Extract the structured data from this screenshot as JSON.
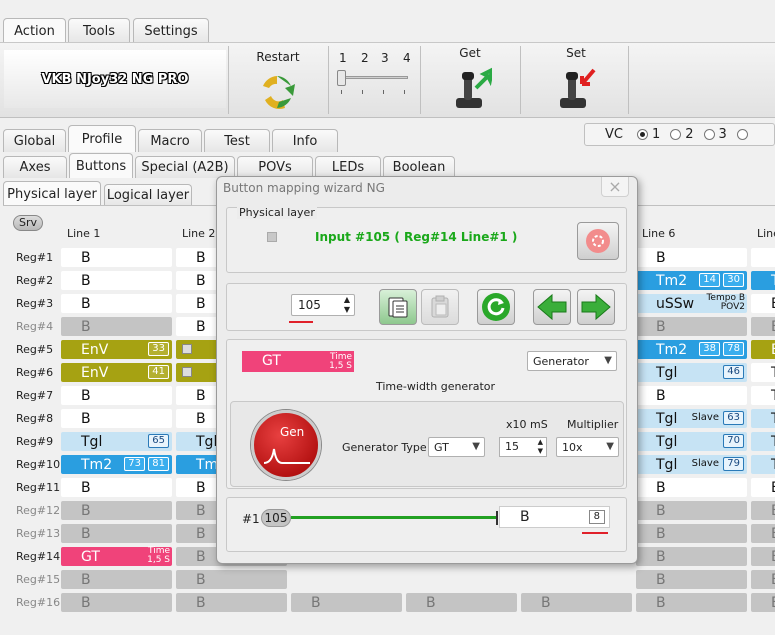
{
  "menu": {
    "tabs": [
      "Action",
      "Tools",
      "Settings"
    ]
  },
  "device": {
    "name": "VKB NJoy32 NG PRO"
  },
  "toolbar": {
    "restart_label": "Restart",
    "slider_ticks": [
      "1",
      "2",
      "3",
      "4"
    ],
    "get_label": "Get",
    "set_label": "Set"
  },
  "main_tabs": [
    "Global",
    "Profile",
    "Macro",
    "Test",
    "Info"
  ],
  "vc": {
    "label": "VC",
    "options": [
      "1",
      "2",
      "3",
      ""
    ],
    "selected": "1"
  },
  "sub_tabs": [
    "Axes",
    "Buttons",
    "Special (A2B)",
    "POVs",
    "LEDs",
    "Boolean"
  ],
  "layer_tabs": [
    "Physical layer",
    "Logical layer"
  ],
  "srv_label": "Srv",
  "line_headers": [
    "Line 1",
    "Line 2",
    "Line 6",
    "Line"
  ],
  "reg_labels": [
    "Reg#1",
    "Reg#2",
    "Reg#3",
    "Reg#4",
    "Reg#5",
    "Reg#6",
    "Reg#7",
    "Reg#8",
    "Reg#9",
    "Reg#10",
    "Reg#11",
    "Reg#12",
    "Reg#13",
    "Reg#14",
    "Reg#15",
    "Reg#16"
  ],
  "line1": [
    {
      "text": "B",
      "style": "white"
    },
    {
      "text": "B",
      "style": "white"
    },
    {
      "text": "B",
      "style": "white"
    },
    {
      "text": "B",
      "style": "gray"
    },
    {
      "text": "EnV",
      "style": "olive",
      "badges": [
        "33"
      ]
    },
    {
      "text": "EnV",
      "style": "olive",
      "badges": [
        "41"
      ]
    },
    {
      "text": "B",
      "style": "white"
    },
    {
      "text": "B",
      "style": "white"
    },
    {
      "text": "Tgl",
      "style": "lblue",
      "badges": [
        "65"
      ]
    },
    {
      "text": "Tm2",
      "style": "dblue",
      "badges": [
        "73",
        "81"
      ]
    },
    {
      "text": "B",
      "style": "white"
    },
    {
      "text": "B",
      "style": "gray"
    },
    {
      "text": "B",
      "style": "gray"
    },
    {
      "text": "GT",
      "style": "pink",
      "time": [
        "Time",
        "1,5 S"
      ]
    },
    {
      "text": "B",
      "style": "gray"
    },
    {
      "text": "B",
      "style": "gray"
    }
  ],
  "line2": [
    {
      "text": "B",
      "style": "white"
    },
    {
      "text": "B",
      "style": "white"
    },
    {
      "text": "B",
      "style": "white"
    },
    {
      "text": "B",
      "style": "white"
    },
    {
      "text": "",
      "style": "olive"
    },
    {
      "text": "",
      "style": "olive"
    },
    {
      "text": "B",
      "style": "white"
    },
    {
      "text": "B",
      "style": "white"
    },
    {
      "text": "Tgl",
      "style": "lblue"
    },
    {
      "text": "Tm",
      "style": "dblue"
    },
    {
      "text": "B",
      "style": "white"
    },
    {
      "text": "B",
      "style": "gray"
    },
    {
      "text": "B",
      "style": "gray"
    },
    {
      "text": "B",
      "style": "gray"
    },
    {
      "text": "B",
      "style": "gray"
    },
    {
      "text": "B",
      "style": "gray"
    }
  ],
  "line6": [
    {
      "text": "B",
      "style": "white"
    },
    {
      "text": "Tm2",
      "style": "dblue",
      "badges": [
        "14",
        "30"
      ]
    },
    {
      "text": "uSSw",
      "style": "lblue",
      "time": [
        "Tempo B",
        "POV2"
      ]
    },
    {
      "text": "B",
      "style": "gray"
    },
    {
      "text": "Tm2",
      "style": "dblue",
      "badges": [
        "38",
        "78"
      ]
    },
    {
      "text": "Tgl",
      "style": "lblue",
      "badges": [
        "46"
      ]
    },
    {
      "text": "B",
      "style": "white"
    },
    {
      "text": "Tgl",
      "style": "lblue",
      "slave": "Slave",
      "badges": [
        "63"
      ]
    },
    {
      "text": "Tgl",
      "style": "lblue",
      "badges": [
        "70"
      ]
    },
    {
      "text": "Tgl",
      "style": "lblue",
      "slave": "Slave",
      "badges": [
        "79"
      ]
    },
    {
      "text": "B",
      "style": "white"
    },
    {
      "text": "B",
      "style": "gray"
    },
    {
      "text": "B",
      "style": "gray"
    },
    {
      "text": "B",
      "style": "gray"
    },
    {
      "text": "B",
      "style": "gray"
    },
    {
      "text": "B",
      "style": "gray"
    }
  ],
  "line7": [
    {
      "text": "",
      "style": "white"
    },
    {
      "text": "T",
      "style": "dblue"
    },
    {
      "text": "B",
      "style": "white"
    },
    {
      "text": "B",
      "style": "gray"
    },
    {
      "text": "E",
      "style": "olive"
    },
    {
      "text": "T",
      "style": "white"
    },
    {
      "text": "T",
      "style": "white"
    },
    {
      "text": "T",
      "style": "lblue"
    },
    {
      "text": "T",
      "style": "lblue"
    },
    {
      "text": "T",
      "style": "lblue"
    },
    {
      "text": "B",
      "style": "white"
    },
    {
      "text": "B",
      "style": "gray"
    },
    {
      "text": "B",
      "style": "gray"
    },
    {
      "text": "B",
      "style": "gray"
    },
    {
      "text": "B",
      "style": "gray"
    },
    {
      "text": "B",
      "style": "gray"
    }
  ],
  "bottom_row_extra": [
    "B",
    "B",
    "B"
  ],
  "dialog": {
    "title": "Button mapping wizard NG",
    "close": "×",
    "physical_group": "Physical layer",
    "input_text": "Input #105  ( Reg#14  Line#1 )",
    "spin_value": "105",
    "func_label": "GT",
    "func_time": [
      "Time",
      "1,5 S"
    ],
    "mode_combo": "Generator",
    "func_caption": "Time-width generator",
    "gen_button": "Gen",
    "gen_type_label": "Generator Type",
    "gen_type_value": "GT",
    "x10ms_label": "x10 mS",
    "x10ms_value": "15",
    "multiplier_label": "Multiplier",
    "multiplier_value": "10x",
    "map_index": "#1",
    "map_source": "105",
    "map_target": "B",
    "map_target_num": "8"
  },
  "colors": {
    "accent_red": "#e0202a",
    "green": "#22a022",
    "input_green": "#1aa81a"
  }
}
